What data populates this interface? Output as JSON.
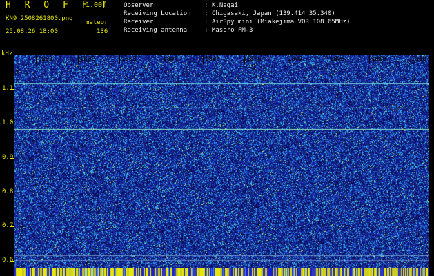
{
  "header": {
    "brand": "H R O F F T",
    "version": "1.00f",
    "filename": "KN9_2508261800.png",
    "meteor_label": "meteor",
    "timestamp": "25.08.26 18:00",
    "count": "136"
  },
  "info": {
    "rows": [
      {
        "key": "Observer",
        "value": "K.Nagai"
      },
      {
        "key": "Receiving Location",
        "value": "Chigasaki, Japan (139.414 35.340)"
      },
      {
        "key": "Receiver",
        "value": "AirSpy mini (Miakejima VOR 108.65MHz)"
      },
      {
        "key": "Receiving antenna",
        "value": "Maspro FM-3"
      }
    ]
  },
  "axes": {
    "y_unit": "kHz",
    "y_ticks": [
      "1.1",
      "1.0",
      "0.9",
      "0.8",
      "0.7",
      "0.6"
    ],
    "x_ticks": [
      "1801",
      "1802",
      "1803",
      "1804",
      "1805",
      "1806",
      "1807",
      "1808",
      "1809",
      "1810"
    ]
  },
  "colors": {
    "header_text": "#e6e60a",
    "info_text": "#f0f0f0",
    "background_noise": "#10107a",
    "signal": "#30d0ff",
    "bar": "#e6e60a"
  }
}
